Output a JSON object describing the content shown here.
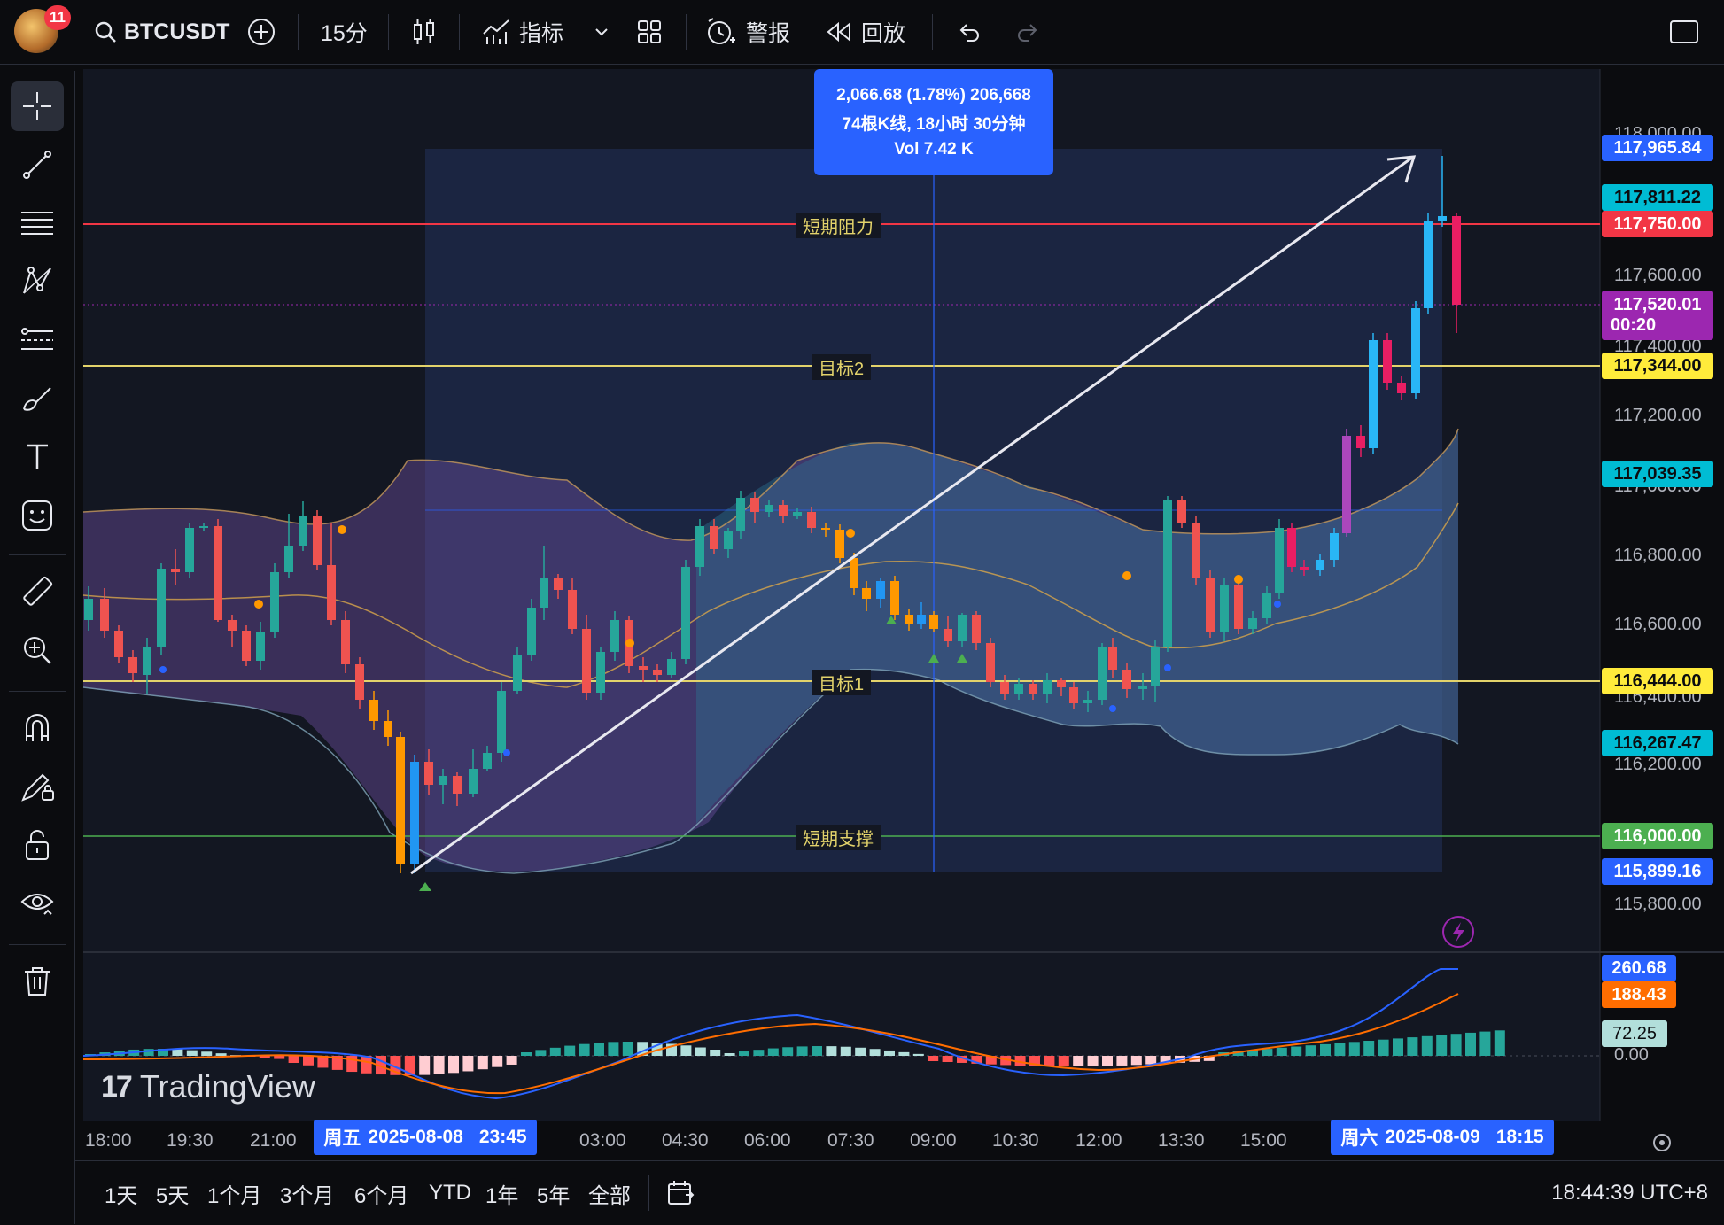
{
  "topbar": {
    "notification_count": "11",
    "symbol": "BTCUSDT",
    "interval": "15分",
    "indicators_label": "指标",
    "alert_label": "警报",
    "replay_label": "回放"
  },
  "measure": {
    "line1": "2,066.68 (1.78%) 206,668",
    "line2": "74根K线, 18小时 30分钟",
    "line3": "Vol 7.42 K"
  },
  "levels": {
    "resistance_label": "短期阻力",
    "target2_label": "目标2",
    "target1_label": "目标1",
    "support_label": "短期支撑"
  },
  "price_labels": [
    {
      "text": "117,965.84",
      "bg": "#2962ff",
      "fg": "#ffffff"
    },
    {
      "text": "117,811.22",
      "bg": "#00bcd4",
      "fg": "#0b0c0f"
    },
    {
      "text": "117,750.00",
      "bg": "#f23645",
      "fg": "#ffffff"
    },
    {
      "text": "117,520.01",
      "bg": "#9c27b0",
      "fg": "#ffffff",
      "sub": "00:20"
    },
    {
      "text": "117,344.00",
      "bg": "#ffeb3b",
      "fg": "#0b0c0f"
    },
    {
      "text": "117,039.35",
      "bg": "#00bcd4",
      "fg": "#0b0c0f"
    },
    {
      "text": "116,444.00",
      "bg": "#ffeb3b",
      "fg": "#0b0c0f"
    },
    {
      "text": "116,267.47",
      "bg": "#00bcd4",
      "fg": "#0b0c0f"
    },
    {
      "text": "116,000.00",
      "bg": "#4caf50",
      "fg": "#ffffff"
    },
    {
      "text": "115,899.16",
      "bg": "#2962ff",
      "fg": "#ffffff"
    }
  ],
  "axis_prices": [
    "118,000.00",
    "117,600.00",
    "117,400.00",
    "117,200.00",
    "117,000.00",
    "116,800.00",
    "116,600.00",
    "116,400.00",
    "116,200.00",
    "115,800.00"
  ],
  "macd": {
    "macd_value": "260.68",
    "signal_value": "188.43",
    "hist_value": "72.25",
    "zero": "0.00",
    "macd_color": "#2962ff",
    "signal_color": "#ff6d00"
  },
  "watermark": "TradingView",
  "time_ticks": [
    "18:00",
    "19:30",
    "21:00",
    "03:00",
    "04:30",
    "06:00",
    "07:30",
    "09:00",
    "10:30",
    "12:00",
    "13:30",
    "15:00"
  ],
  "time_highlight_left": {
    "day": "周五",
    "date": "2025-08-08",
    "time": "23:45"
  },
  "time_highlight_right": {
    "day": "周六",
    "date": "2025-08-09",
    "time": "18:15"
  },
  "ranges": [
    "1天",
    "5天",
    "1个月",
    "3个月",
    "6个月",
    "YTD",
    "1年",
    "5年",
    "全部"
  ],
  "clock": "18:44:39 UTC+8"
}
